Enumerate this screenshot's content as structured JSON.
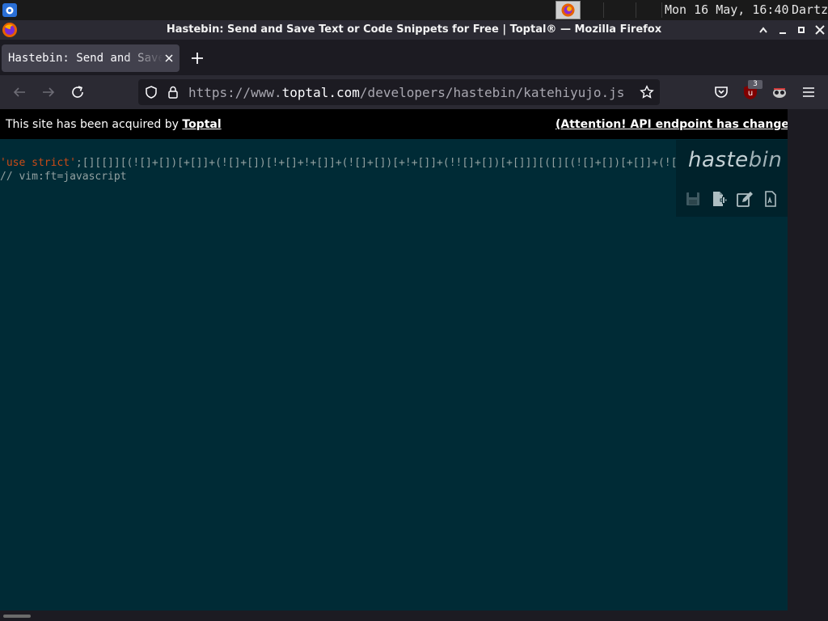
{
  "system_panel": {
    "clock": "Mon 16 May, 16:40",
    "user": "Dartz"
  },
  "window": {
    "title": "Hastebin: Send and Save Text or Code Snippets for Free | Toptal® — Mozilla Firefox"
  },
  "tabs": [
    {
      "label": "Hastebin: Send and Save Text or Code Snippets for Free | Toptal®"
    }
  ],
  "urlbar": {
    "prefix": "https://www.",
    "host": "toptal.com",
    "path": "/developers/hastebin/katehiyujo.js"
  },
  "toolbar": {
    "extension_badge": "3"
  },
  "notice": {
    "acquired_text": "This site has been acquired by ",
    "acquired_link": "Toptal",
    "api_notice": "(Attention! API endpoint has changed)"
  },
  "editor": {
    "line1_string": "'use strict'",
    "line1_rest": ";[][[]][(![]+[])[+[]]+(![]+[])[!+[]+!+[]]+(![]+[])[+!+[]]+(!![]+[])[+[]]][([][(![]+[])[+[]]+(![]+[])[!+[]+!+[]]+(![]+[])[+!+[]]+(!![]+[])[+[]]]+[])",
    "line2": "// vim:ft=javascript"
  },
  "hastebin": {
    "logo_main": "haste",
    "logo_thin": "bin",
    "buttons": [
      "save-icon",
      "new-document-icon",
      "duplicate-edit-icon",
      "raw-text-icon"
    ]
  },
  "colors": {
    "editor_bg": "#002b36",
    "string": "#cb4b16",
    "code_text": "#93a1a1",
    "notice_bg": "#000000",
    "browser_chrome": "#2b2a33"
  }
}
